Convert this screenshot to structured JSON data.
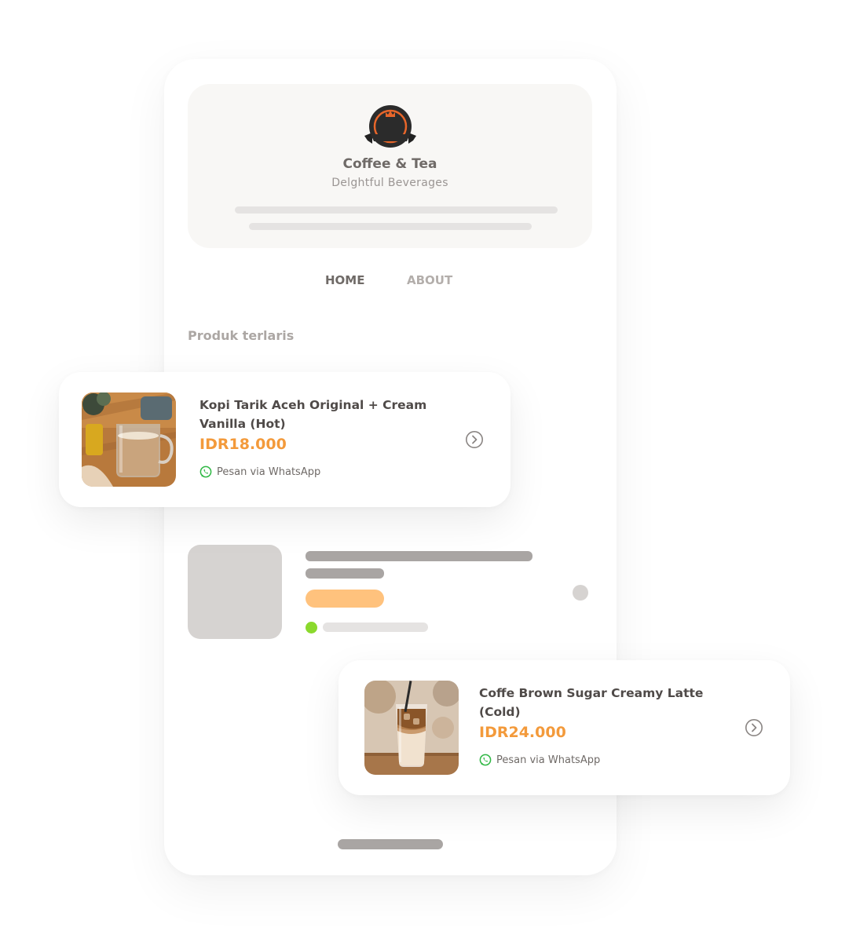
{
  "brand": {
    "title": "Coffee & Tea",
    "subtitle": "Delghtful Beverages",
    "logo_icon": "crown-badge-icon",
    "accent": "#e8662a"
  },
  "nav": {
    "home": "HOME",
    "about": "ABOUT"
  },
  "section": {
    "title": "Produk terlaris"
  },
  "products": [
    {
      "name": "Kopi Tarik Aceh Original + Cream Vanilla (Hot)",
      "price": "IDR18.000",
      "cta": "Pesan via WhatsApp",
      "image": "hot-coffee-glass-photo"
    },
    {
      "name": "Coffe Brown Sugar Creamy Latte (Cold)",
      "price": "IDR24.000",
      "cta": "Pesan via WhatsApp",
      "image": "iced-latte-glass-photo"
    }
  ],
  "colors": {
    "price": "#f39a3b",
    "whatsapp": "#2db742",
    "skeleton_dark": "#a9a5a3",
    "skeleton_light": "#e5e3e2",
    "skeleton_orange": "#ffc27d",
    "online_dot": "#8bd92d"
  }
}
